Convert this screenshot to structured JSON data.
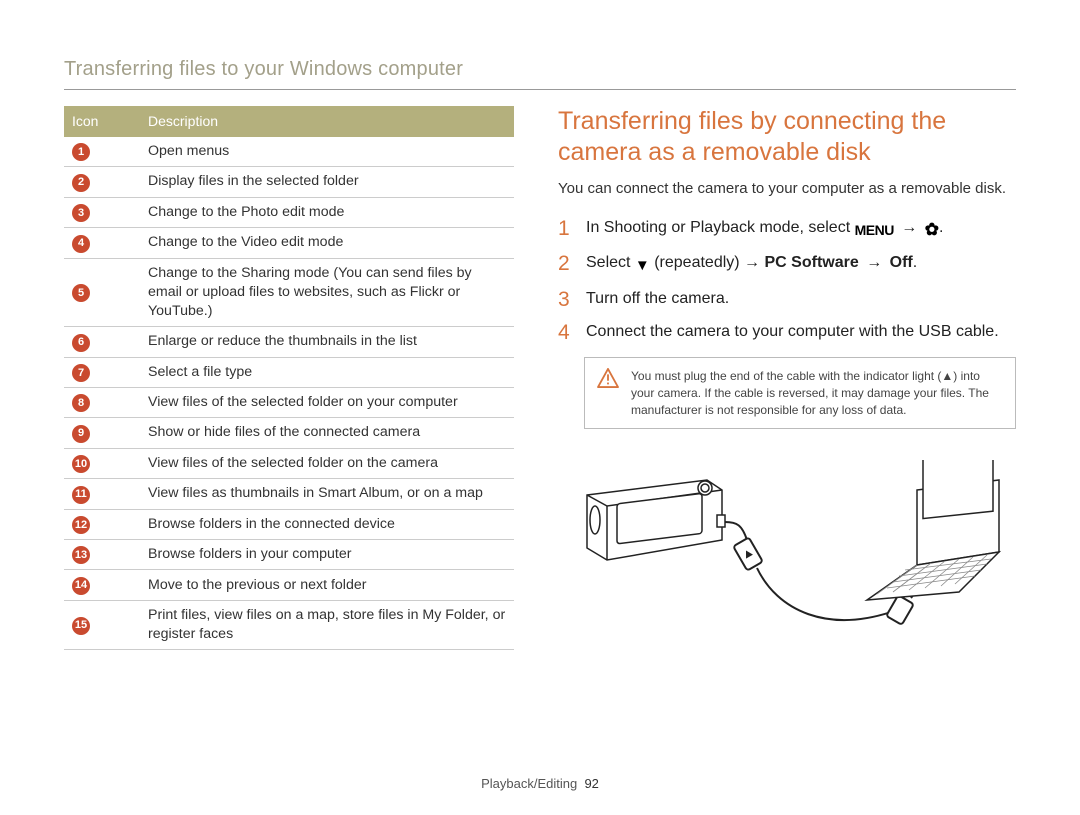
{
  "page": {
    "title": "Transferring files to your Windows computer",
    "footer_section": "Playback/Editing",
    "footer_page": "92"
  },
  "table": {
    "headers": {
      "icon": "Icon",
      "desc": "Description"
    },
    "rows": [
      {
        "n": "1",
        "desc": "Open menus"
      },
      {
        "n": "2",
        "desc": "Display files in the selected folder"
      },
      {
        "n": "3",
        "desc": "Change to the Photo edit mode"
      },
      {
        "n": "4",
        "desc": "Change to the Video edit mode"
      },
      {
        "n": "5",
        "desc": "Change to the Sharing mode (You can send files by email or upload files to websites, such as Flickr or YouTube.)"
      },
      {
        "n": "6",
        "desc": "Enlarge or reduce the thumbnails in the list"
      },
      {
        "n": "7",
        "desc": "Select a file type"
      },
      {
        "n": "8",
        "desc": "View files of the selected folder on your computer"
      },
      {
        "n": "9",
        "desc": "Show or hide files of the connected camera"
      },
      {
        "n": "10",
        "desc": "View files of the selected folder on the camera"
      },
      {
        "n": "11",
        "desc": "View files as thumbnails in Smart Album, or on a map"
      },
      {
        "n": "12",
        "desc": "Browse folders in the connected device"
      },
      {
        "n": "13",
        "desc": "Browse folders in your computer"
      },
      {
        "n": "14",
        "desc": "Move to the previous or next folder"
      },
      {
        "n": "15",
        "desc": "Print files, view files on a map, store files in My Folder, or register faces"
      }
    ]
  },
  "section": {
    "heading": "Transferring files by connecting the camera as a removable disk",
    "intro": "You can connect the camera to your computer as a removable disk.",
    "steps": {
      "s1_a": "In Shooting or Playback mode, select ",
      "s1_menu": "MENU",
      "s1_arrow": " → ",
      "s1_end": ".",
      "s2_a": "Select ",
      "s2_b": " (repeatedly) → ",
      "s2_pc": "PC Software",
      "s2_arrow2": " → ",
      "s2_off": "Off",
      "s2_end": ".",
      "s3": "Turn off the camera.",
      "s4": "Connect the camera to your computer with the USB cable."
    },
    "note": "You must plug the end of the cable with the indicator light (▲) into your camera. If the cable is reversed, it may damage your files. The manufacturer is not responsible for any loss of data."
  }
}
